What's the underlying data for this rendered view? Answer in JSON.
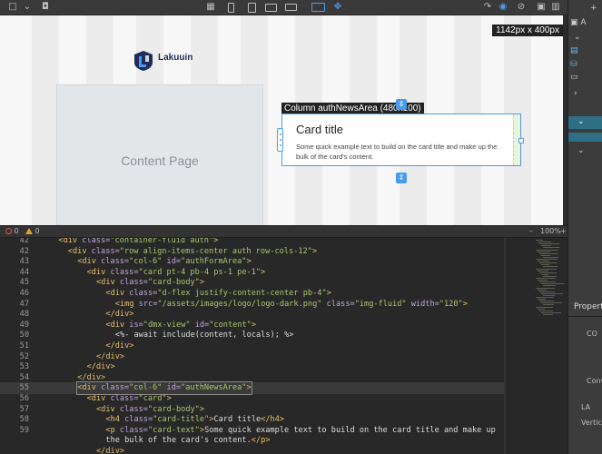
{
  "preview": {
    "size_label": "1142px x 400px",
    "logo_text": "Lakuuin",
    "content_placeholder": "Content Page",
    "selection_label": "Column authNewsArea (480x100)",
    "card": {
      "title": "Card title",
      "text": "Some quick example text to build on the card title and make up the bulk of the card's content."
    }
  },
  "right_panel": {
    "top_label": "A",
    "properties_title": "Properties",
    "section_label": "CO",
    "item_conv": "Conv",
    "section_label_2": "LA",
    "item_vertical": "Vertical"
  },
  "status": {
    "errors": "0",
    "warnings": "0",
    "zoom": "100%"
  },
  "editor": {
    "lines": [
      {
        "n": "42",
        "indent": 2,
        "html": [
          [
            "tag",
            "<div "
          ],
          [
            "attr",
            "class="
          ],
          [
            "str",
            "\"container-fluid auth\""
          ],
          [
            "tag",
            ">"
          ]
        ]
      },
      {
        "n": "42",
        "indent": 4,
        "html": [
          [
            "tag",
            "<div "
          ],
          [
            "attr",
            "class="
          ],
          [
            "str",
            "\"row align-items-center auth row-cols-12\""
          ],
          [
            "tag",
            ">"
          ]
        ]
      },
      {
        "n": "43",
        "indent": 6,
        "html": [
          [
            "tag",
            "<div "
          ],
          [
            "attr",
            "class="
          ],
          [
            "str",
            "\"col-6\" "
          ],
          [
            "attr",
            "id="
          ],
          [
            "str",
            "\"authFormArea\""
          ],
          [
            "tag",
            ">"
          ]
        ]
      },
      {
        "n": "44",
        "indent": 8,
        "html": [
          [
            "tag",
            "<div "
          ],
          [
            "attr",
            "class="
          ],
          [
            "str",
            "\"card pt-4 pb-4 ps-1 pe-1\""
          ],
          [
            "tag",
            ">"
          ]
        ]
      },
      {
        "n": "45",
        "indent": 10,
        "html": [
          [
            "tag",
            "<div "
          ],
          [
            "attr",
            "class="
          ],
          [
            "str",
            "\"card-body\""
          ],
          [
            "tag",
            ">"
          ]
        ]
      },
      {
        "n": "46",
        "indent": 12,
        "html": [
          [
            "tag",
            "<div "
          ],
          [
            "attr",
            "class="
          ],
          [
            "str",
            "\"d-flex justify-content-center pb-4\""
          ],
          [
            "tag",
            ">"
          ]
        ]
      },
      {
        "n": "47",
        "indent": 14,
        "html": [
          [
            "tag",
            "<img "
          ],
          [
            "attr",
            "src="
          ],
          [
            "str",
            "\"/assets/images/logo/logo-dark.png\" "
          ],
          [
            "attr",
            "class="
          ],
          [
            "str",
            "\"img-fluid\" "
          ],
          [
            "attr",
            "width="
          ],
          [
            "str",
            "\"120\""
          ],
          [
            "tag",
            ">"
          ]
        ]
      },
      {
        "n": "48",
        "indent": 12,
        "html": [
          [
            "tag",
            "</div>"
          ]
        ]
      },
      {
        "n": "49",
        "indent": 12,
        "html": [
          [
            "tag",
            "<div "
          ],
          [
            "attr",
            "is="
          ],
          [
            "str",
            "\"dmx-view\" "
          ],
          [
            "attr",
            "id="
          ],
          [
            "str",
            "\"content\""
          ],
          [
            "tag",
            ">"
          ]
        ]
      },
      {
        "n": "50",
        "indent": 14,
        "html": [
          [
            "txt",
            "<%- await include(content, locals); %>"
          ]
        ]
      },
      {
        "n": "51",
        "indent": 12,
        "html": [
          [
            "tag",
            "</div>"
          ]
        ]
      },
      {
        "n": "52",
        "indent": 10,
        "html": [
          [
            "tag",
            "</div>"
          ]
        ]
      },
      {
        "n": "53",
        "indent": 8,
        "html": [
          [
            "tag",
            "</div>"
          ]
        ]
      },
      {
        "n": "54",
        "indent": 6,
        "html": [
          [
            "tag",
            "</div>"
          ]
        ]
      },
      {
        "n": "55",
        "indent": 6,
        "hl": true,
        "html": [
          [
            "tag",
            "<div "
          ],
          [
            "attr",
            "class="
          ],
          [
            "str",
            "\"col-6\" "
          ],
          [
            "attr",
            "id="
          ],
          [
            "str",
            "\"authNewsArea\""
          ],
          [
            "tag",
            ">"
          ]
        ]
      },
      {
        "n": "56",
        "indent": 8,
        "html": [
          [
            "tag",
            "<div "
          ],
          [
            "attr",
            "class="
          ],
          [
            "str",
            "\"card\""
          ],
          [
            "tag",
            ">"
          ]
        ]
      },
      {
        "n": "57",
        "indent": 10,
        "html": [
          [
            "tag",
            "<div "
          ],
          [
            "attr",
            "class="
          ],
          [
            "str",
            "\"card-body\""
          ],
          [
            "tag",
            ">"
          ]
        ]
      },
      {
        "n": "58",
        "indent": 12,
        "html": [
          [
            "tag",
            "<h4 "
          ],
          [
            "attr",
            "class="
          ],
          [
            "str",
            "\"card-title\""
          ],
          [
            "tag",
            ">"
          ],
          [
            "txt",
            "Card title"
          ],
          [
            "tag",
            "</h4>"
          ]
        ]
      },
      {
        "n": "59",
        "indent": 12,
        "html": [
          [
            "tag",
            "<p "
          ],
          [
            "attr",
            "class="
          ],
          [
            "str",
            "\"card-text\""
          ],
          [
            "tag",
            ">"
          ],
          [
            "txt",
            "Some quick example text to build on the card title and make up"
          ]
        ]
      },
      {
        "n": "",
        "indent": 12,
        "html": [
          [
            "txt",
            "the bulk of the card's content."
          ],
          [
            "tag",
            "</p>"
          ]
        ]
      },
      {
        "n": "",
        "indent": 10,
        "html": [
          [
            "tag",
            "</div>"
          ]
        ]
      }
    ]
  },
  "colors": {
    "accent": "#4a9bf0",
    "editor_bg": "#282828",
    "tag": "#e8bf6a",
    "attr": "#c0a4d8",
    "string": "#a8c46b"
  },
  "icons": [
    "square-icon",
    "camera-icon",
    "grid-icon",
    "phone-icon",
    "tablet-icon",
    "tablet-landscape-icon",
    "laptop-icon",
    "monitor-icon",
    "move-icon",
    "eye-icon",
    "visibility-off-icon",
    "wrap-icon",
    "plus-icon"
  ]
}
